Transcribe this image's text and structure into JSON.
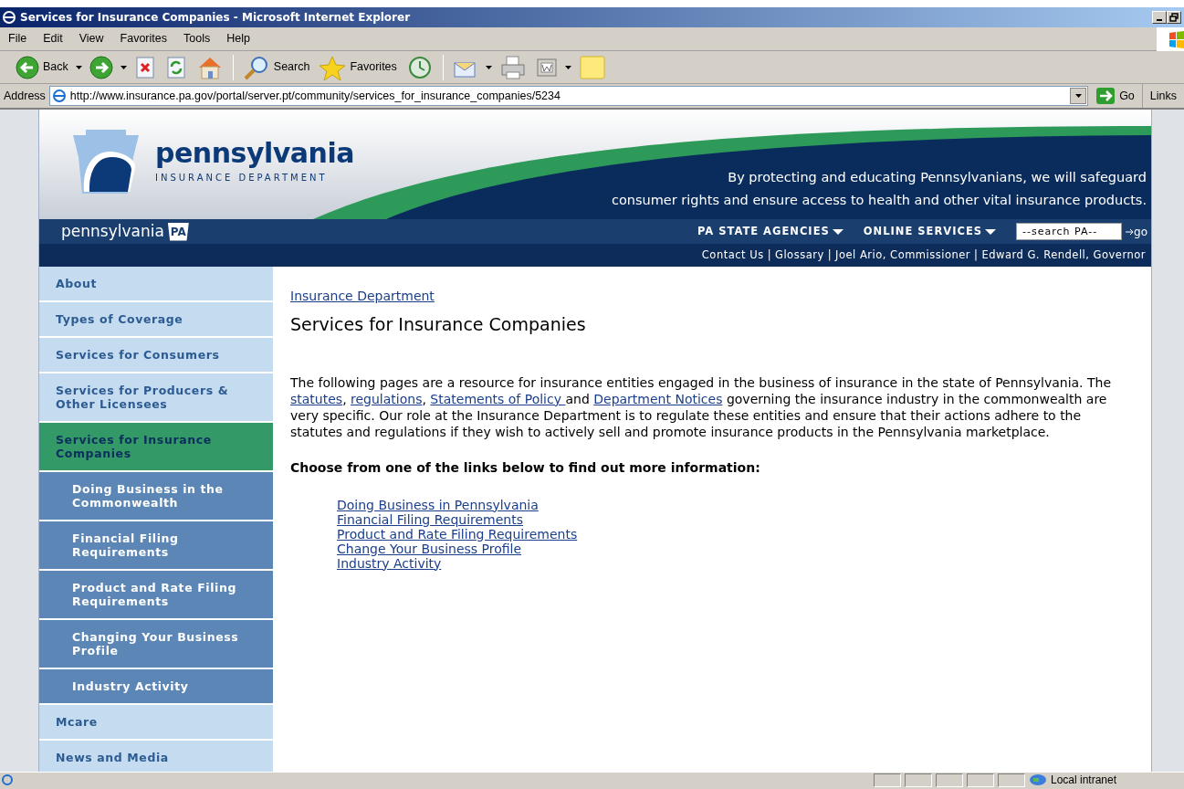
{
  "window": {
    "title": "Services for Insurance Companies - Microsoft Internet Explorer"
  },
  "menu": [
    "File",
    "Edit",
    "View",
    "Favorites",
    "Tools",
    "Help"
  ],
  "toolbar": [
    {
      "kind": "back",
      "label": "Back"
    },
    {
      "kind": "forward"
    },
    {
      "kind": "stop"
    },
    {
      "kind": "refresh"
    },
    {
      "kind": "home"
    },
    {
      "kind": "search",
      "label": "Search"
    },
    {
      "kind": "favorites",
      "label": "Favorites"
    },
    {
      "kind": "history"
    },
    {
      "kind": "mail"
    },
    {
      "kind": "print"
    },
    {
      "kind": "edit"
    },
    {
      "kind": "note"
    }
  ],
  "address": {
    "label": "Address",
    "url": "http://www.insurance.pa.gov/portal/server.pt/community/services_for_insurance_companies/5234",
    "go": "Go",
    "links": "Links"
  },
  "banner": {
    "title": "pennsylvania",
    "subtitle": "INSURANCE DEPARTMENT",
    "tagline": [
      "By protecting and educating Pennsylvanians, we will safeguard",
      "consumer rights and ensure access to health and other vital insurance products."
    ],
    "wordmark": "pennsylvania",
    "badge": "PA",
    "nav": [
      "PA STATE AGENCIES",
      "ONLINE SERVICES"
    ],
    "search": {
      "value": "--search PA--"
    },
    "go": "go",
    "util_separator": "|",
    "util_links": [
      "Contact Us",
      "Glossary",
      "Joel Ario, Commissioner",
      "Edward G. Rendell, Governor"
    ]
  },
  "sidebar": {
    "items": [
      {
        "label": "About",
        "selected": false
      },
      {
        "label": "Types of Coverage",
        "selected": false
      },
      {
        "label": "Services for Consumers",
        "selected": false
      },
      {
        "label": "Services for Producers & Other Licensees",
        "selected": false
      },
      {
        "label": "Services for Insurance Companies",
        "selected": true,
        "children": [
          {
            "label": "Doing Business in the Commonwealth",
            "selected": false
          },
          {
            "label": "Financial Filing Requirements",
            "selected": false
          },
          {
            "label": "Product and Rate Filing Requirements",
            "selected": false
          },
          {
            "label": "Changing Your Business Profile",
            "selected": false
          },
          {
            "label": "Industry Activity",
            "selected": false
          }
        ]
      },
      {
        "label": "Mcare",
        "selected": false
      },
      {
        "label": "News and Media",
        "selected": false
      }
    ]
  },
  "content": {
    "breadcrumb": "Insurance Department",
    "heading": "Services for Insurance Companies",
    "paragraph": [
      {
        "text": "The following pages are a resource for insurance entities engaged in the business of insurance in the state of Pennsylvania. The "
      },
      {
        "text": "statutes",
        "link": true
      },
      {
        "text": ", "
      },
      {
        "text": "regulations",
        "link": true
      },
      {
        "text": ", "
      },
      {
        "text": "Statements of Policy ",
        "link": true
      },
      {
        "text": "and "
      },
      {
        "text": "Department Notices",
        "link": true
      },
      {
        "text": " governing the insurance industry in the commonwealth are very specific. Our role at the Insurance Department is to regulate these entities and ensure that their actions adhere to the statutes and regulations if they wish to actively sell and promote insurance products in the Pennsylvania marketplace."
      }
    ],
    "prompt": "Choose from one of the links below to find out more information:",
    "links": [
      "Doing Business in Pennsylvania",
      "Financial Filing Requirements",
      "Product and Rate Filing Requirements",
      "Change Your Business Profile",
      "Industry Activity"
    ]
  },
  "status_bar": {
    "zone": "Local intranet"
  }
}
